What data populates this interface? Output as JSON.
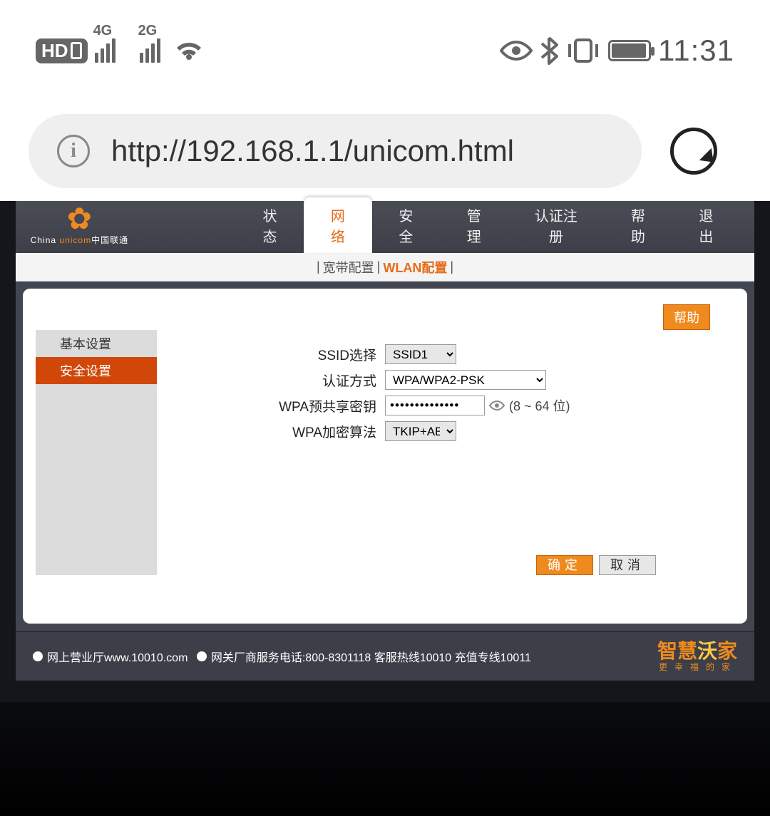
{
  "statusbar": {
    "net1": "4G",
    "net2": "2G",
    "time": "11:31"
  },
  "browser": {
    "url": "http://192.168.1.1/unicom.html"
  },
  "logo": {
    "brand_en": "China",
    "brand_unicom": "unicom",
    "brand_cn": "中国联通"
  },
  "nav": {
    "items": [
      {
        "label": "状态"
      },
      {
        "label": "网络",
        "active": true
      },
      {
        "label": "安全"
      },
      {
        "label": "管理"
      },
      {
        "label": "认证注册"
      },
      {
        "label": "帮助"
      },
      {
        "label": "退出"
      }
    ]
  },
  "subnav": {
    "bb": "宽带配置",
    "wlan": "WLAN配置"
  },
  "help_button": "帮助",
  "sidemenu": {
    "items": [
      {
        "label": "基本设置"
      },
      {
        "label": "安全设置",
        "active": true
      }
    ]
  },
  "form": {
    "ssid_label": "SSID选择",
    "ssid_value": "SSID1",
    "auth_label": "认证方式",
    "auth_value": "WPA/WPA2-PSK",
    "key_label": "WPA预共享密钥",
    "key_value": "••••••••••••••",
    "key_hint": "(8 ~ 64 位)",
    "alg_label": "WPA加密算法",
    "alg_value": "TKIP+AES"
  },
  "buttons": {
    "ok": "确定",
    "cancel": "取消"
  },
  "footer": {
    "shop": "网上营业厅www.10010.com",
    "service": "网关厂商服务电话:800-8301118 客服热线10010 充值专线10011",
    "logo_main_1": "智慧",
    "logo_main_2": "沃",
    "logo_main_3": "家",
    "logo_sub": "更幸福的家"
  }
}
